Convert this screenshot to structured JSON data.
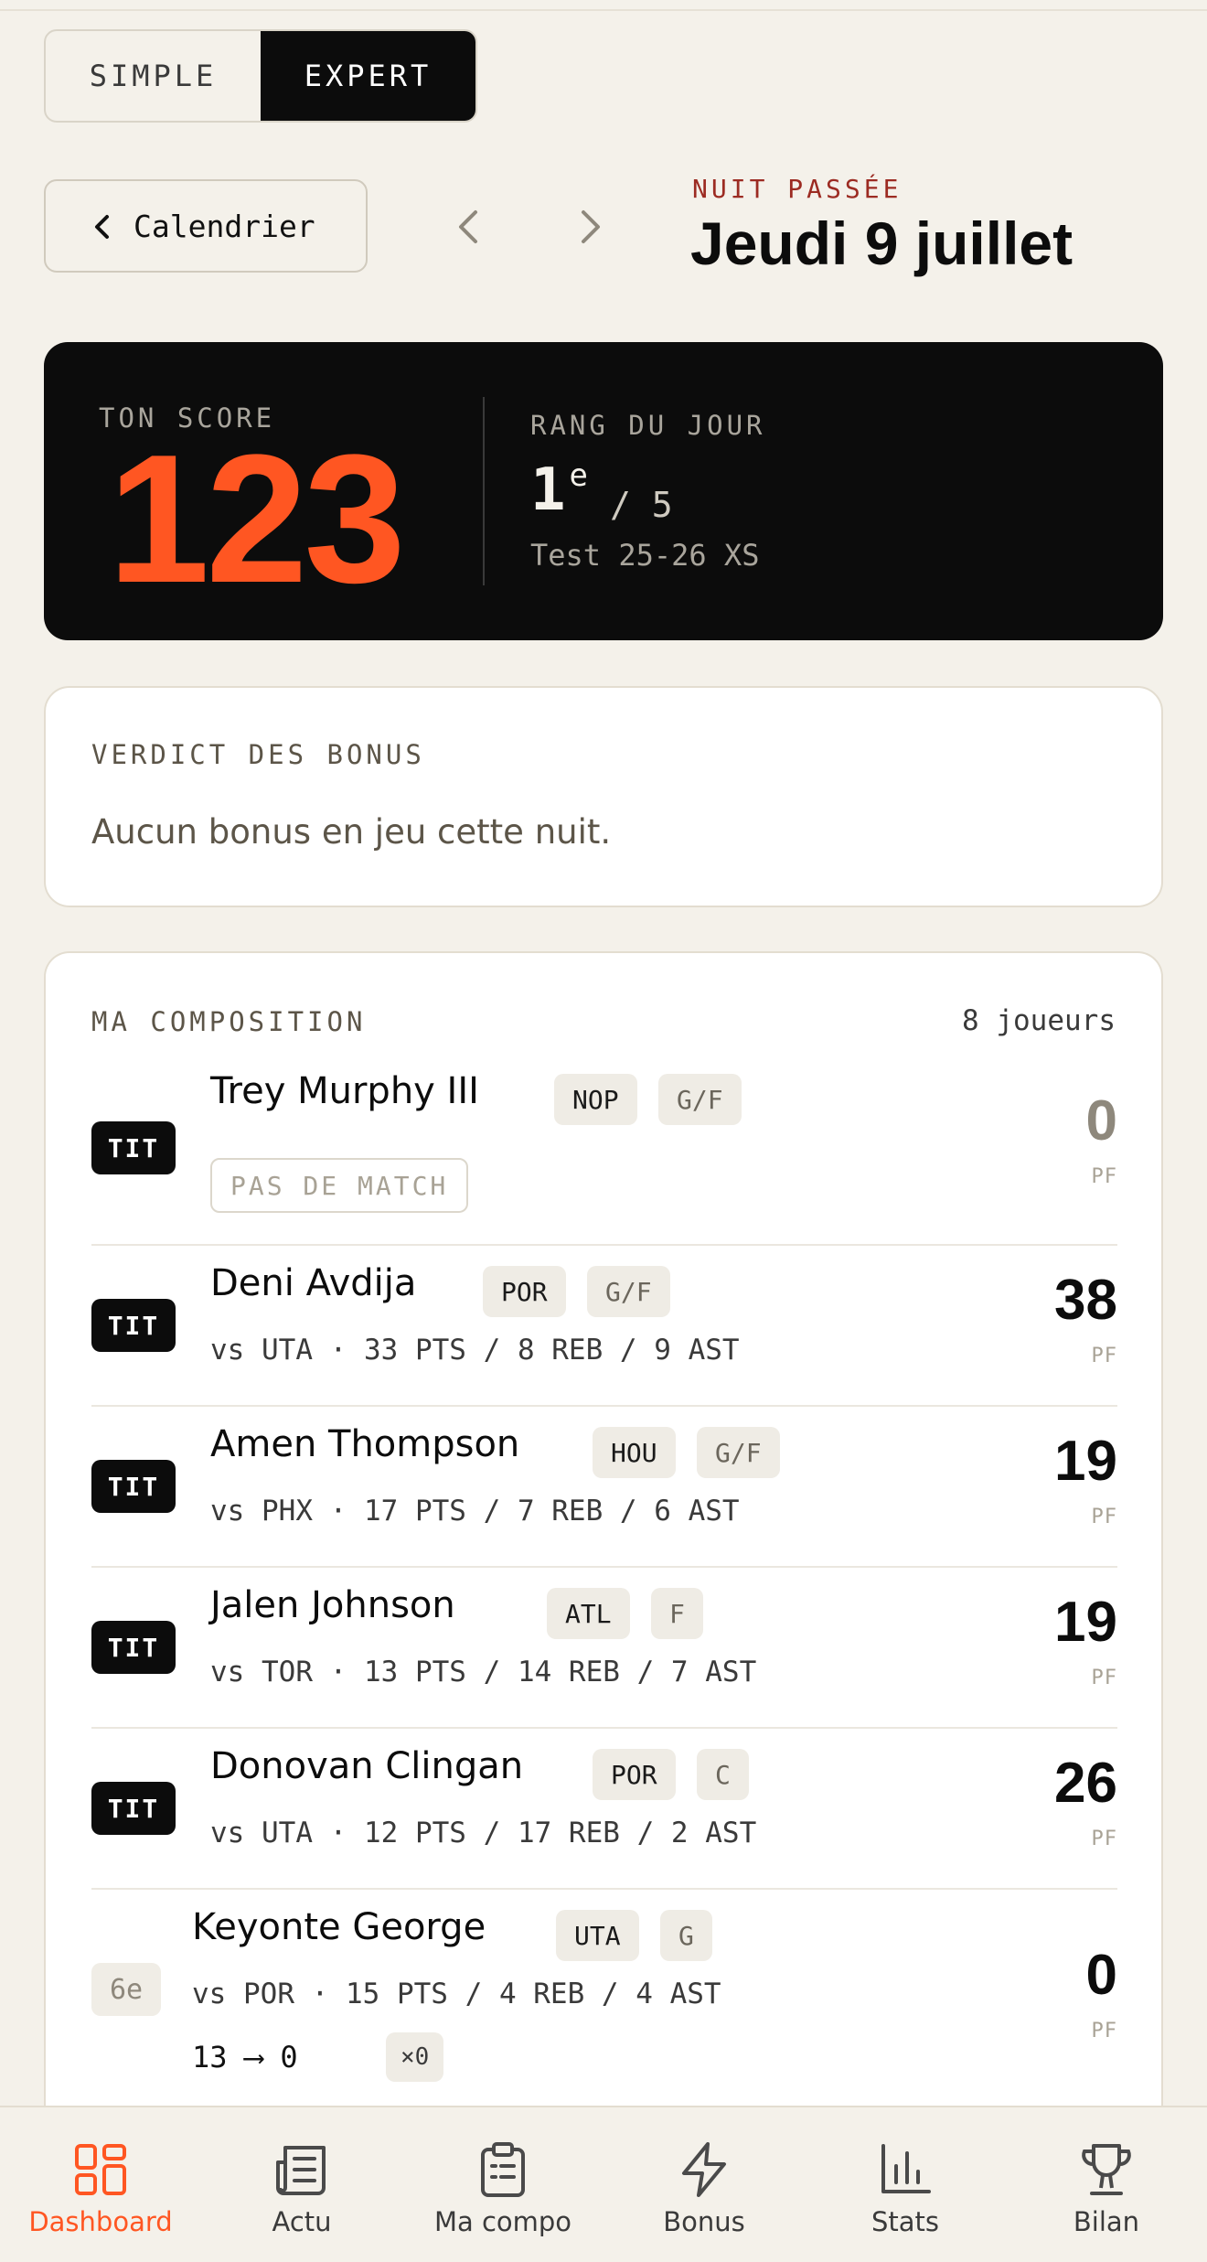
{
  "mode_toggle": {
    "simple_label": "SIMPLE",
    "expert_label": "EXPERT",
    "active": "expert"
  },
  "header": {
    "calendar_label": "Calendrier",
    "eyebrow": "NUIT PASSÉE",
    "date_title": "Jeudi 9 juillet"
  },
  "score_card": {
    "score_label": "TON SCORE",
    "score_value": "123",
    "rank_label": "RANG DU JOUR",
    "rank_value": "1",
    "rank_suffix": "e",
    "rank_total": "/ 5",
    "league_name": "Test 25-26 XS"
  },
  "bonus": {
    "title": "VERDICT DES BONUS",
    "text": "Aucun bonus en jeu cette nuit."
  },
  "composition": {
    "title": "MA COMPOSITION",
    "count": "8 joueurs",
    "pf_label": "PF",
    "players": [
      {
        "tag": "TIT",
        "name": "Trey Murphy III",
        "team": "NOP",
        "position": "G/F",
        "status": "PAS DE MATCH",
        "points": "0"
      },
      {
        "tag": "TIT",
        "name": "Deni Avdija",
        "team": "POR",
        "position": "G/F",
        "stats": "vs UTA · 33 PTS / 8 REB / 9 AST",
        "points": "38"
      },
      {
        "tag": "TIT",
        "name": "Amen Thompson",
        "team": "HOU",
        "position": "G/F",
        "stats": "vs PHX · 17 PTS / 7 REB / 6 AST",
        "points": "19"
      },
      {
        "tag": "TIT",
        "name": "Jalen Johnson",
        "team": "ATL",
        "position": "F",
        "stats": "vs TOR · 13 PTS / 14 REB / 7 AST",
        "points": "19"
      },
      {
        "tag": "TIT",
        "name": "Donovan Clingan",
        "team": "POR",
        "position": "C",
        "stats": "vs UTA · 12 PTS / 17 REB / 2 AST",
        "points": "26"
      },
      {
        "tag": "6e",
        "name": "Keyonte George",
        "team": "UTA",
        "position": "G",
        "stats": "vs POR · 15 PTS / 4 REB / 4 AST",
        "conversion": "13 ⟶ 0",
        "multiplier": "×0",
        "points": "0"
      }
    ]
  },
  "bottom_nav": {
    "items": [
      {
        "label": "Dashboard",
        "icon": "dashboard-icon"
      },
      {
        "label": "Actu",
        "icon": "newspaper-icon"
      },
      {
        "label": "Ma compo",
        "icon": "clipboard-icon"
      },
      {
        "label": "Bonus",
        "icon": "lightning-icon"
      },
      {
        "label": "Stats",
        "icon": "bar-chart-icon"
      },
      {
        "label": "Bilan",
        "icon": "trophy-icon"
      }
    ],
    "active": "Dashboard",
    "accent_color": "#ff5622"
  },
  "colors": {
    "background": "#f4f1ea",
    "accent": "#ff5622",
    "eyebrow_red": "#9c2b22",
    "card_dark": "#0c0c0c"
  }
}
